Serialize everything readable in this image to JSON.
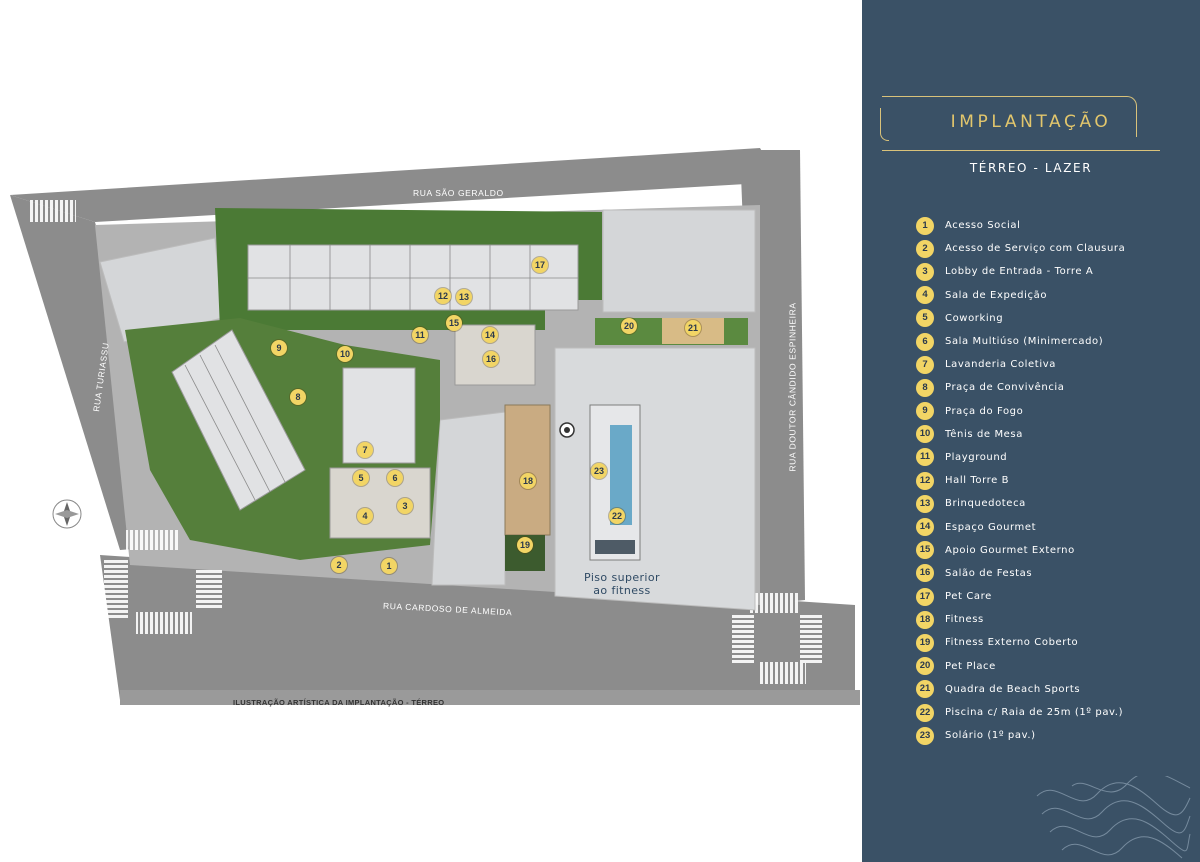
{
  "panel": {
    "title": "IMPLANTAÇÃO",
    "subtitle": "TÉRREO - LAZER",
    "legend": [
      {
        "num": "1",
        "label": "Acesso Social"
      },
      {
        "num": "2",
        "label": "Acesso de Serviço com Clausura"
      },
      {
        "num": "3",
        "label": "Lobby de Entrada - Torre A"
      },
      {
        "num": "4",
        "label": "Sala de Expedição"
      },
      {
        "num": "5",
        "label": "Coworking"
      },
      {
        "num": "6",
        "label": "Sala Multiúso (Minimercado)"
      },
      {
        "num": "7",
        "label": "Lavanderia Coletiva"
      },
      {
        "num": "8",
        "label": "Praça de Convivência"
      },
      {
        "num": "9",
        "label": "Praça do Fogo"
      },
      {
        "num": "10",
        "label": "Tênis de Mesa"
      },
      {
        "num": "11",
        "label": "Playground"
      },
      {
        "num": "12",
        "label": "Hall Torre B"
      },
      {
        "num": "13",
        "label": "Brinquedoteca"
      },
      {
        "num": "14",
        "label": "Espaço Gourmet"
      },
      {
        "num": "15",
        "label": "Apoio Gourmet Externo"
      },
      {
        "num": "16",
        "label": "Salão de Festas"
      },
      {
        "num": "17",
        "label": "Pet Care"
      },
      {
        "num": "18",
        "label": "Fitness"
      },
      {
        "num": "19",
        "label": "Fitness Externo Coberto"
      },
      {
        "num": "20",
        "label": "Pet Place"
      },
      {
        "num": "21",
        "label": "Quadra de Beach Sports"
      },
      {
        "num": "22",
        "label": "Piscina c/ Raia de 25m (1º pav.)"
      },
      {
        "num": "23",
        "label": "Solário (1º pav.)"
      }
    ]
  },
  "map": {
    "streets": {
      "north": "RUA SÃO GERALDO",
      "west": "RUA TURIASSU",
      "south": "RUA CARDOSO DE ALMEIDA",
      "east": "RUA DOUTOR CÂNDIDO ESPINHEIRA"
    },
    "caption": "ILUSTRAÇÃO ARTÍSTICA DA IMPLANTAÇÃO - TÉRREO",
    "fitness_note_line1": "Piso superior",
    "fitness_note_line2": "ao fitness",
    "markers": [
      "1",
      "2",
      "3",
      "4",
      "5",
      "6",
      "7",
      "8",
      "9",
      "10",
      "11",
      "12",
      "13",
      "14",
      "15",
      "16",
      "17",
      "18",
      "19",
      "20",
      "21",
      "22",
      "23"
    ]
  },
  "colors": {
    "panel_bg": "#3a5166",
    "accent_gold": "#e2c66c",
    "marker_fill": "#f2d565",
    "street": "#8b8b8b",
    "green": "#4f7a3a",
    "building": "#d2d4d6"
  }
}
